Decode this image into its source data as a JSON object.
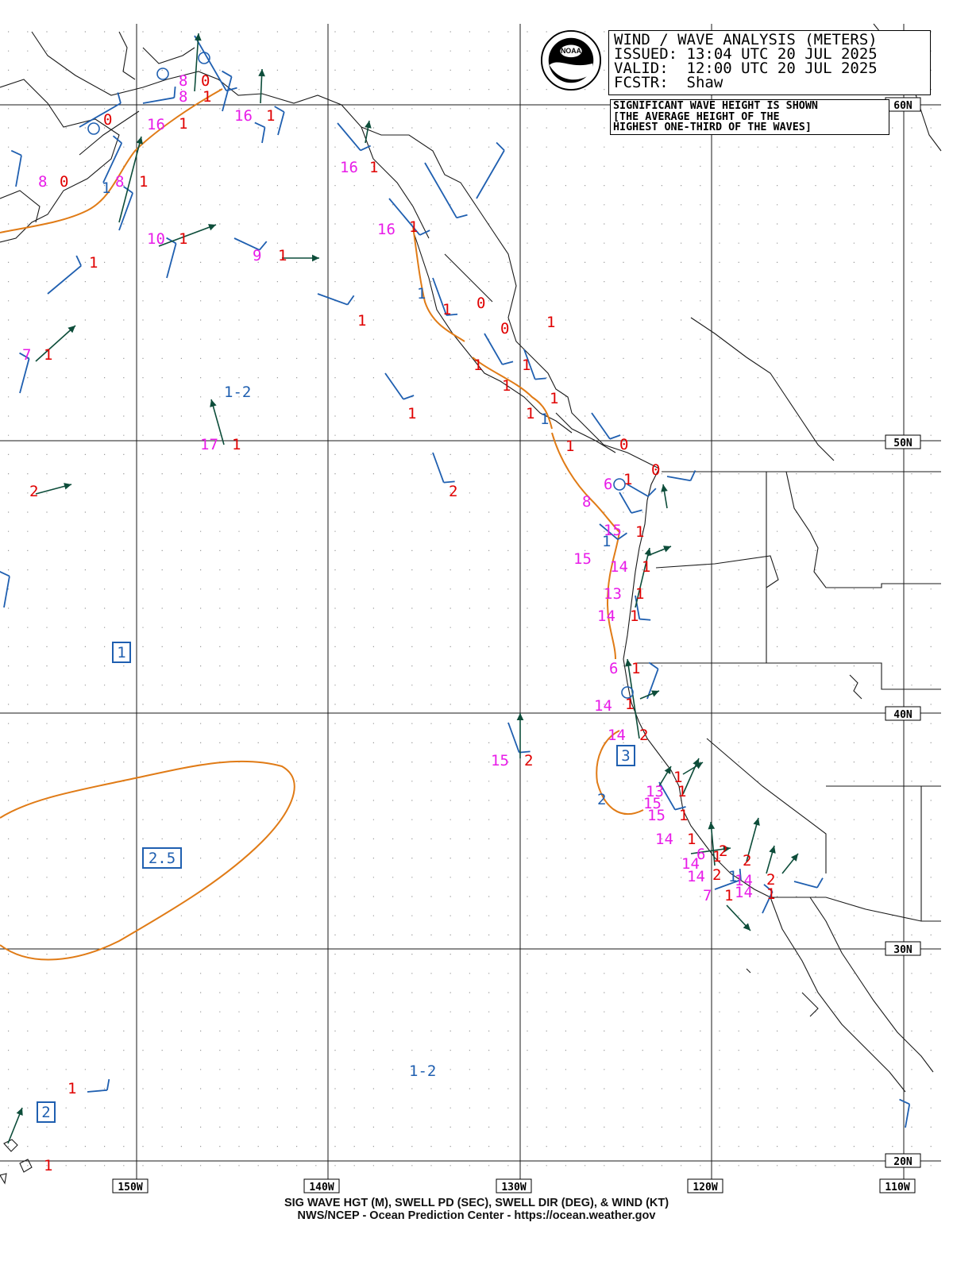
{
  "header": {
    "title": "WIND / WAVE ANALYSIS (METERS)",
    "issued": "ISSUED: 13:04 UTC 20 JUL 2025",
    "valid": "VALID:  12:00 UTC 20 JUL 2025",
    "forecaster": "FCSTR:  Shaw"
  },
  "note": {
    "line1": "SIGNIFICANT WAVE HEIGHT IS SHOWN",
    "line2": "[THE AVERAGE HEIGHT OF THE",
    "line3": "HIGHEST ONE-THIRD OF THE WAVES]"
  },
  "footer": {
    "line1": "SIG WAVE HGT (M), SWELL PD (SEC), SWELL DIR (DEG), & WIND (KT)",
    "line2": "NWS/NCEP - Ocean Prediction Center - https://ocean.weather.gov"
  },
  "longitude_labels": [
    "150W",
    "140W",
    "130W",
    "120W",
    "110W"
  ],
  "latitude_labels": [
    "60N",
    "50N",
    "40N",
    "30N",
    "20N"
  ],
  "boxed_wave_heights": [
    "1",
    "3",
    "2.5",
    "2"
  ],
  "blue_height_labels": [
    "1-2",
    "1-2",
    "1",
    "1",
    "1",
    "1",
    "2",
    "1"
  ],
  "colors": {
    "grid": "#1a1a1a",
    "coast": "#1a1a1a",
    "wave_contour": "#e07b16",
    "wind_barb": "#1f5fb0",
    "swell_arrow": "#0d4d3a",
    "period_label": "#e81ce8",
    "height_label": "#e00000",
    "analysis_label": "#1f5fb0"
  },
  "period_labels": [
    "8",
    "8",
    "16",
    "16",
    "16",
    "8",
    "8",
    "10",
    "9",
    "16",
    "7",
    "17",
    "8",
    "6",
    "15",
    "15",
    "14",
    "13",
    "14",
    "6",
    "14",
    "14",
    "15",
    "13",
    "15",
    "15",
    "14",
    "14",
    "14",
    "6",
    "14",
    "14",
    "7"
  ],
  "height_labels": [
    "0",
    "1",
    "1",
    "1",
    "0",
    "1",
    "1",
    "0",
    "1",
    "1",
    "1",
    "1",
    "1",
    "1",
    "1",
    "1",
    "1",
    "0",
    "0",
    "1",
    "1",
    "1",
    "1",
    "1",
    "1",
    "1",
    "0",
    "1",
    "0",
    "1",
    "1",
    "1",
    "1",
    "1",
    "1",
    "2",
    "2",
    "2",
    "2",
    "1",
    "1",
    "1",
    "1",
    "1",
    "1",
    "1",
    "2",
    "2",
    "2",
    "1",
    "1",
    "2"
  ]
}
